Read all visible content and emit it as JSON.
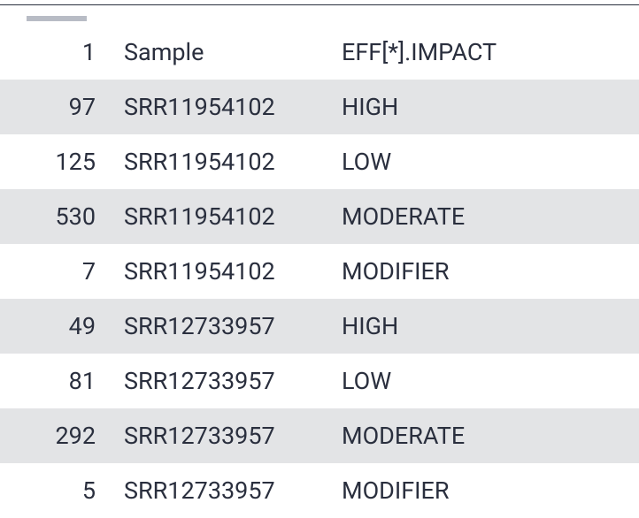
{
  "table": {
    "header": {
      "num": "1",
      "sample": "Sample",
      "impact": "EFF[*].IMPACT"
    },
    "rows": [
      {
        "num": "97",
        "sample": "SRR11954102",
        "impact": "HIGH"
      },
      {
        "num": "125",
        "sample": "SRR11954102",
        "impact": "LOW"
      },
      {
        "num": "530",
        "sample": "SRR11954102",
        "impact": "MODERATE"
      },
      {
        "num": "7",
        "sample": "SRR11954102",
        "impact": "MODIFIER"
      },
      {
        "num": "49",
        "sample": "SRR12733957",
        "impact": "HIGH"
      },
      {
        "num": "81",
        "sample": "SRR12733957",
        "impact": "LOW"
      },
      {
        "num": "292",
        "sample": "SRR12733957",
        "impact": "MODERATE"
      },
      {
        "num": "5",
        "sample": "SRR12733957",
        "impact": "MODIFIER"
      }
    ]
  }
}
